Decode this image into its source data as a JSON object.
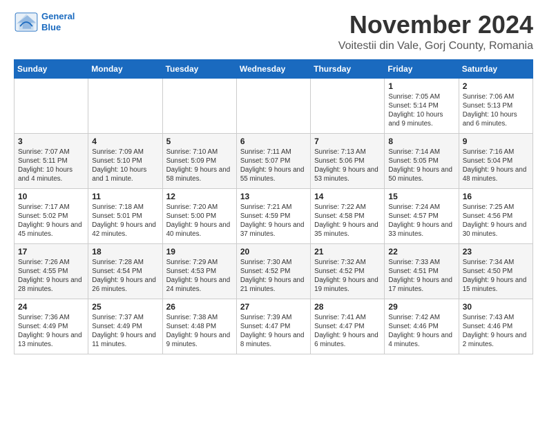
{
  "header": {
    "logo_line1": "General",
    "logo_line2": "Blue",
    "month_title": "November 2024",
    "location": "Voitestii din Vale, Gorj County, Romania"
  },
  "weekdays": [
    "Sunday",
    "Monday",
    "Tuesday",
    "Wednesday",
    "Thursday",
    "Friday",
    "Saturday"
  ],
  "weeks": [
    [
      {
        "day": "",
        "info": ""
      },
      {
        "day": "",
        "info": ""
      },
      {
        "day": "",
        "info": ""
      },
      {
        "day": "",
        "info": ""
      },
      {
        "day": "",
        "info": ""
      },
      {
        "day": "1",
        "info": "Sunrise: 7:05 AM\nSunset: 5:14 PM\nDaylight: 10 hours and 9 minutes."
      },
      {
        "day": "2",
        "info": "Sunrise: 7:06 AM\nSunset: 5:13 PM\nDaylight: 10 hours and 6 minutes."
      }
    ],
    [
      {
        "day": "3",
        "info": "Sunrise: 7:07 AM\nSunset: 5:11 PM\nDaylight: 10 hours and 4 minutes."
      },
      {
        "day": "4",
        "info": "Sunrise: 7:09 AM\nSunset: 5:10 PM\nDaylight: 10 hours and 1 minute."
      },
      {
        "day": "5",
        "info": "Sunrise: 7:10 AM\nSunset: 5:09 PM\nDaylight: 9 hours and 58 minutes."
      },
      {
        "day": "6",
        "info": "Sunrise: 7:11 AM\nSunset: 5:07 PM\nDaylight: 9 hours and 55 minutes."
      },
      {
        "day": "7",
        "info": "Sunrise: 7:13 AM\nSunset: 5:06 PM\nDaylight: 9 hours and 53 minutes."
      },
      {
        "day": "8",
        "info": "Sunrise: 7:14 AM\nSunset: 5:05 PM\nDaylight: 9 hours and 50 minutes."
      },
      {
        "day": "9",
        "info": "Sunrise: 7:16 AM\nSunset: 5:04 PM\nDaylight: 9 hours and 48 minutes."
      }
    ],
    [
      {
        "day": "10",
        "info": "Sunrise: 7:17 AM\nSunset: 5:02 PM\nDaylight: 9 hours and 45 minutes."
      },
      {
        "day": "11",
        "info": "Sunrise: 7:18 AM\nSunset: 5:01 PM\nDaylight: 9 hours and 42 minutes."
      },
      {
        "day": "12",
        "info": "Sunrise: 7:20 AM\nSunset: 5:00 PM\nDaylight: 9 hours and 40 minutes."
      },
      {
        "day": "13",
        "info": "Sunrise: 7:21 AM\nSunset: 4:59 PM\nDaylight: 9 hours and 37 minutes."
      },
      {
        "day": "14",
        "info": "Sunrise: 7:22 AM\nSunset: 4:58 PM\nDaylight: 9 hours and 35 minutes."
      },
      {
        "day": "15",
        "info": "Sunrise: 7:24 AM\nSunset: 4:57 PM\nDaylight: 9 hours and 33 minutes."
      },
      {
        "day": "16",
        "info": "Sunrise: 7:25 AM\nSunset: 4:56 PM\nDaylight: 9 hours and 30 minutes."
      }
    ],
    [
      {
        "day": "17",
        "info": "Sunrise: 7:26 AM\nSunset: 4:55 PM\nDaylight: 9 hours and 28 minutes."
      },
      {
        "day": "18",
        "info": "Sunrise: 7:28 AM\nSunset: 4:54 PM\nDaylight: 9 hours and 26 minutes."
      },
      {
        "day": "19",
        "info": "Sunrise: 7:29 AM\nSunset: 4:53 PM\nDaylight: 9 hours and 24 minutes."
      },
      {
        "day": "20",
        "info": "Sunrise: 7:30 AM\nSunset: 4:52 PM\nDaylight: 9 hours and 21 minutes."
      },
      {
        "day": "21",
        "info": "Sunrise: 7:32 AM\nSunset: 4:52 PM\nDaylight: 9 hours and 19 minutes."
      },
      {
        "day": "22",
        "info": "Sunrise: 7:33 AM\nSunset: 4:51 PM\nDaylight: 9 hours and 17 minutes."
      },
      {
        "day": "23",
        "info": "Sunrise: 7:34 AM\nSunset: 4:50 PM\nDaylight: 9 hours and 15 minutes."
      }
    ],
    [
      {
        "day": "24",
        "info": "Sunrise: 7:36 AM\nSunset: 4:49 PM\nDaylight: 9 hours and 13 minutes."
      },
      {
        "day": "25",
        "info": "Sunrise: 7:37 AM\nSunset: 4:49 PM\nDaylight: 9 hours and 11 minutes."
      },
      {
        "day": "26",
        "info": "Sunrise: 7:38 AM\nSunset: 4:48 PM\nDaylight: 9 hours and 9 minutes."
      },
      {
        "day": "27",
        "info": "Sunrise: 7:39 AM\nSunset: 4:47 PM\nDaylight: 9 hours and 8 minutes."
      },
      {
        "day": "28",
        "info": "Sunrise: 7:41 AM\nSunset: 4:47 PM\nDaylight: 9 hours and 6 minutes."
      },
      {
        "day": "29",
        "info": "Sunrise: 7:42 AM\nSunset: 4:46 PM\nDaylight: 9 hours and 4 minutes."
      },
      {
        "day": "30",
        "info": "Sunrise: 7:43 AM\nSunset: 4:46 PM\nDaylight: 9 hours and 2 minutes."
      }
    ]
  ]
}
